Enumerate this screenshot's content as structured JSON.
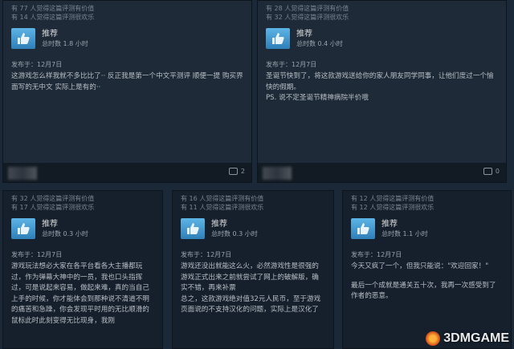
{
  "reviews": [
    {
      "helpful_count": "有 77 人觉得这篇评测有价值",
      "funny_count": "有 14 人觉得这篇评测很欢乐",
      "recommend": "推荐",
      "hours": "总时数 1.8 小时",
      "posted": "发布于：12月7日",
      "body": [
        "这游戏怎么样我就不多比比了·· 反正我是第一个中文平测评 顺便一提 购买界面写的无中文 实际上是有的··"
      ],
      "comments": "2"
    },
    {
      "helpful_count": "有 28 人觉得这篇评测有价值",
      "funny_count": "有 32 人觉得这篇评测很欢乐",
      "recommend": "推荐",
      "hours": "总时数 0.4 小时",
      "posted": "发布于：12月7日",
      "body": [
        "圣诞节快到了，将这款游戏送给你的家人朋友同学同事，让他们度过一个愉快的假期。",
        "PS. 说不定圣诞节精神病院半价哦"
      ],
      "comments": "0"
    },
    {
      "helpful_count": "有 32 人觉得这篇评测有价值",
      "funny_count": "有 17 人觉得这篇评测很欢乐",
      "recommend": "推荐",
      "hours": "总时数 0.3 小时",
      "posted": "发布于：12月7日",
      "body": [
        "游戏玩法想必大家在各平台看各大主播都玩过，作为弹幕大神中的一员，我也口头指挥过，可是说起来容易，做起来难，真的当自己上手的时候，你才能体会到那种说不清道不明的痛苦和急躁，你会发现平时用的无比顺滑的鼠标此时此刻变得无比现身，我刚"
      ]
    },
    {
      "helpful_count": "有 16 人觉得这篇评测有价值",
      "funny_count": "有 11 人觉得这篇评测很欢乐",
      "recommend": "推荐",
      "hours": "总时数 0.3 小时",
      "posted": "发布于：12月7日",
      "body": [
        "游戏还没出就能这么火，必然游戏性是很强的游戏正式出来之前就尝试了网上的破解版，确实不错，再来补票",
        "总之，这款游戏绝对值32元人民币，至于游戏页面说的不支持汉化的问题，实际上是汉化了"
      ]
    },
    {
      "helpful_count": "有 12 人觉得这篇评测有价值",
      "funny_count": "有 12 人觉得这篇评测很欢乐",
      "recommend": "推荐",
      "hours": "总时数 1.1 小时",
      "posted": "发布于：12月7日",
      "body": [
        "今天又疯了一个，但我只能说：\"欢迎回家！\"",
        "最后一个成就是通关五十次，我再一次感受到了作者的恶意。"
      ]
    }
  ],
  "watermark": "3DMGAME"
}
